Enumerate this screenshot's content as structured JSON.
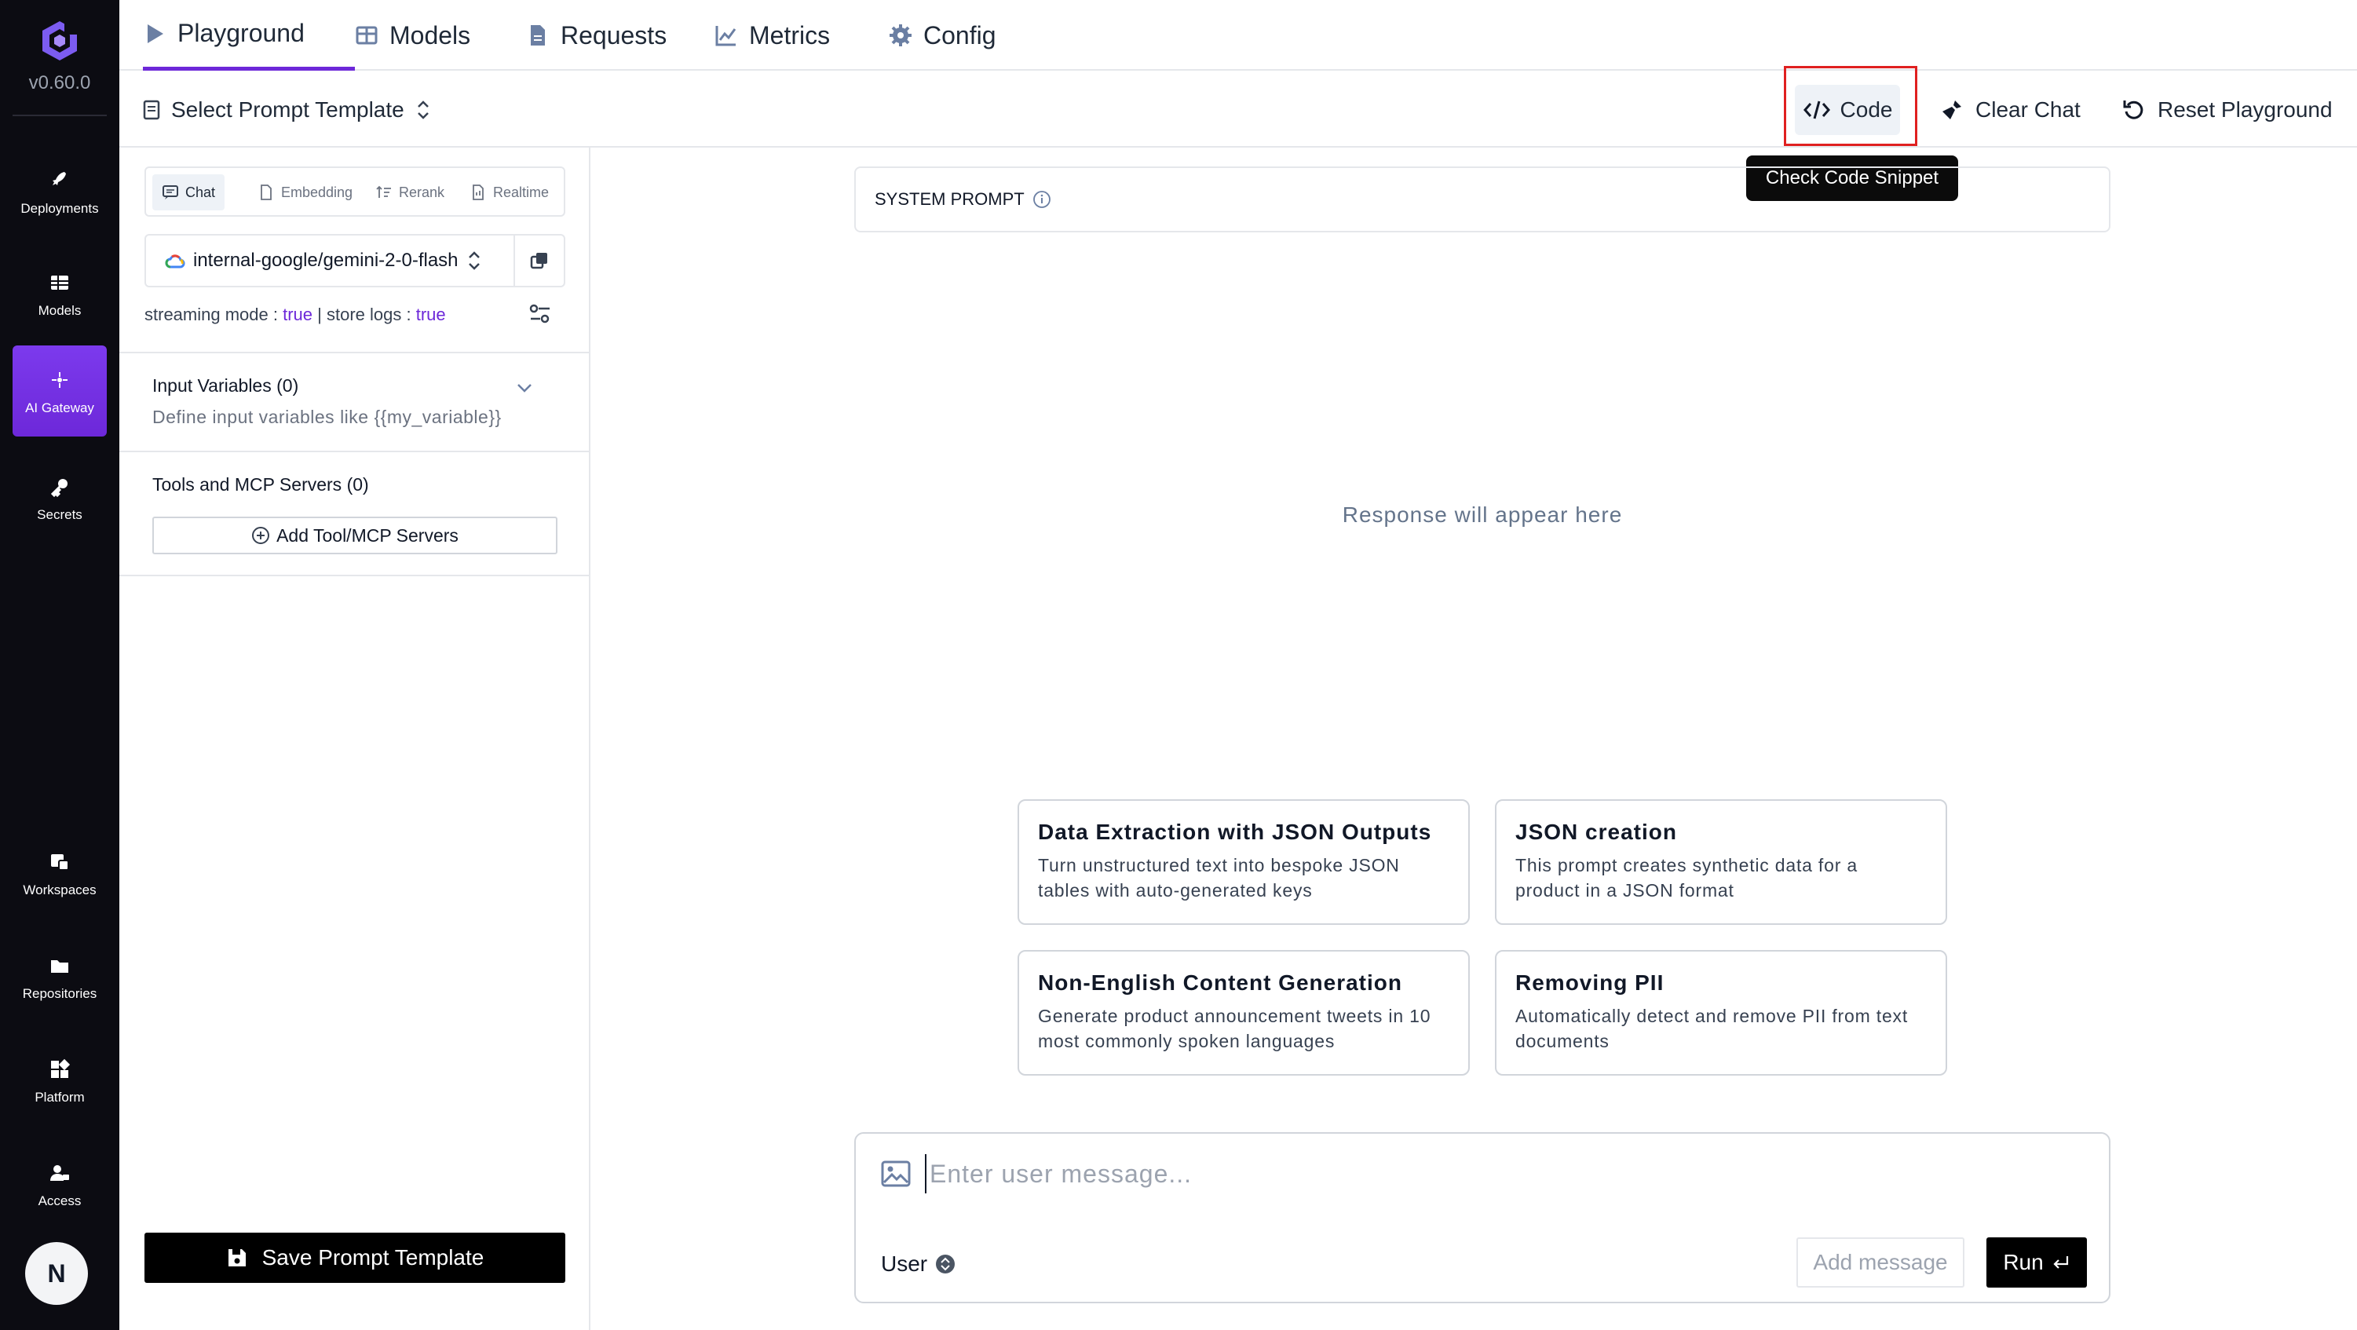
{
  "app": {
    "version": "v0.60.0",
    "user_initial": "N"
  },
  "leftnav": {
    "items": [
      {
        "label": "Deployments",
        "icon": "rocket-icon"
      },
      {
        "label": "Models",
        "icon": "grid-icon"
      },
      {
        "label": "AI Gateway",
        "icon": "gateway-icon",
        "active": true
      },
      {
        "label": "Secrets",
        "icon": "key-icon"
      },
      {
        "label": "Workspaces",
        "icon": "workspace-icon"
      },
      {
        "label": "Repositories",
        "icon": "folder-icon"
      },
      {
        "label": "Platform",
        "icon": "platform-icon"
      },
      {
        "label": "Access",
        "icon": "user-lock-icon"
      }
    ]
  },
  "tabs": [
    {
      "label": "Playground",
      "icon": "play-icon",
      "active": true
    },
    {
      "label": "Models",
      "icon": "table-icon"
    },
    {
      "label": "Requests",
      "icon": "document-icon"
    },
    {
      "label": "Metrics",
      "icon": "chart-line-icon"
    },
    {
      "label": "Config",
      "icon": "gear-icon"
    }
  ],
  "toolbar": {
    "select_template": "Select Prompt Template",
    "code": "Code",
    "code_tooltip": "Check Code Snippet",
    "clear_chat": "Clear Chat",
    "reset": "Reset Playground"
  },
  "panel": {
    "modes": [
      "Chat",
      "Embedding",
      "Rerank",
      "Realtime"
    ],
    "model": "internal-google/gemini-2-0-flash",
    "streaming_label": "streaming mode :",
    "streaming_value": "true",
    "store_logs_label": "store logs :",
    "store_logs_value": "true",
    "input_variables_title": "Input Variables (0)",
    "input_variables_sub": "Define input variables like {{my_variable}}",
    "tools_title": "Tools and MCP Servers (0)",
    "add_tool": "Add Tool/MCP Servers",
    "save_template": "Save Prompt Template"
  },
  "main": {
    "system_prompt_label": "SYSTEM PROMPT",
    "response_placeholder": "Response will appear here",
    "cards": [
      {
        "title": "Data Extraction with JSON Outputs",
        "desc": "Turn unstructured text into bespoke JSON tables with auto-generated keys"
      },
      {
        "title": "JSON creation",
        "desc": "This prompt creates synthetic data for a product in a JSON format"
      },
      {
        "title": "Non-English Content Generation",
        "desc": "Generate product announcement tweets in 10 most commonly spoken languages"
      },
      {
        "title": "Removing PII",
        "desc": "Automatically detect and remove PII from text documents"
      }
    ],
    "composer": {
      "placeholder": "Enter user message...",
      "role": "User",
      "add_message": "Add message",
      "run": "Run"
    }
  },
  "colors": {
    "accent": "#6d28d9",
    "nav_bg": "#0c0c12",
    "highlight": "#e02020"
  }
}
